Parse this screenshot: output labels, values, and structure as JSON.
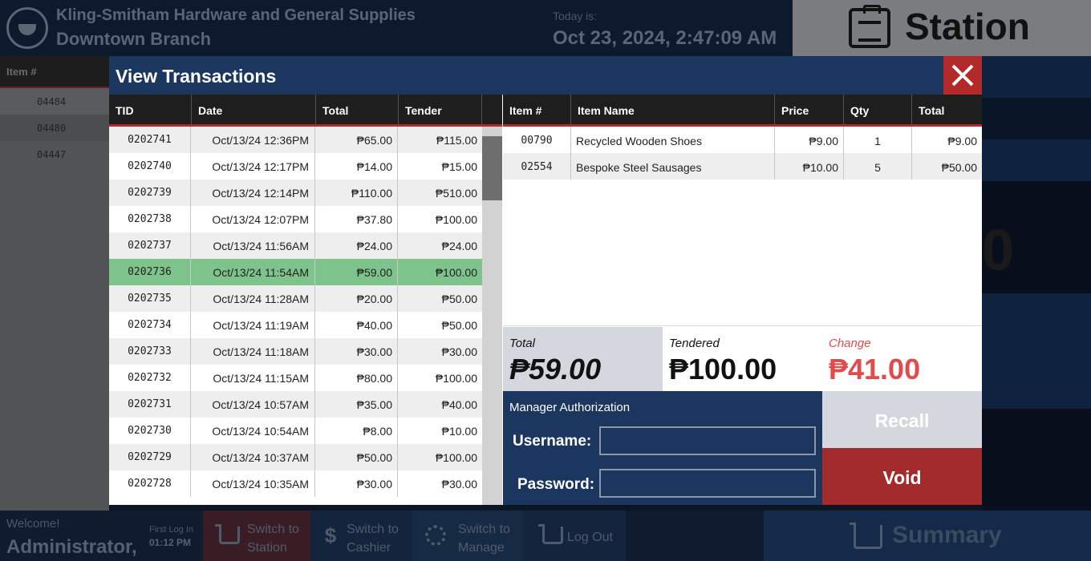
{
  "header": {
    "store_name": "Kling-Smitham Hardware and General Supplies",
    "branch": "Downtown Branch",
    "today_label": "Today is:",
    "today_value": "Oct 23, 2024, 2:47:09 AM",
    "station_label": "Station"
  },
  "background_list": {
    "header": "Item #",
    "rows": [
      "04484",
      "04480",
      "04447"
    ]
  },
  "bottombar": {
    "welcome": "Welcome!",
    "user": "Administrator,",
    "first_login_label": "First Log In",
    "first_login_time": "01:12 PM",
    "switch_station": [
      "Switch to",
      "Station"
    ],
    "switch_cashier": [
      "Switch to",
      "Cashier"
    ],
    "switch_manage": [
      "Switch to",
      "Manage"
    ],
    "logout": "Log Out",
    "summary": "Summary"
  },
  "modal": {
    "title": "View Transactions",
    "tx_columns": [
      "TID",
      "Date",
      "Total",
      "Tender"
    ],
    "transactions": [
      {
        "tid": "0202741",
        "date": "Oct/13/24 12:36PM",
        "total": "₱65.00",
        "tender": "₱115.00"
      },
      {
        "tid": "0202740",
        "date": "Oct/13/24 12:17PM",
        "total": "₱14.00",
        "tender": "₱15.00"
      },
      {
        "tid": "0202739",
        "date": "Oct/13/24 12:14PM",
        "total": "₱110.00",
        "tender": "₱510.00"
      },
      {
        "tid": "0202738",
        "date": "Oct/13/24 12:07PM",
        "total": "₱37.80",
        "tender": "₱100.00"
      },
      {
        "tid": "0202737",
        "date": "Oct/13/24 11:56AM",
        "total": "₱24.00",
        "tender": "₱24.00"
      },
      {
        "tid": "0202736",
        "date": "Oct/13/24 11:54AM",
        "total": "₱59.00",
        "tender": "₱100.00"
      },
      {
        "tid": "0202735",
        "date": "Oct/13/24 11:28AM",
        "total": "₱20.00",
        "tender": "₱50.00"
      },
      {
        "tid": "0202734",
        "date": "Oct/13/24 11:19AM",
        "total": "₱40.00",
        "tender": "₱50.00"
      },
      {
        "tid": "0202733",
        "date": "Oct/13/24 11:18AM",
        "total": "₱30.00",
        "tender": "₱30.00"
      },
      {
        "tid": "0202732",
        "date": "Oct/13/24 11:15AM",
        "total": "₱80.00",
        "tender": "₱100.00"
      },
      {
        "tid": "0202731",
        "date": "Oct/13/24 10:57AM",
        "total": "₱35.00",
        "tender": "₱40.00"
      },
      {
        "tid": "0202730",
        "date": "Oct/13/24 10:54AM",
        "total": "₱8.00",
        "tender": "₱10.00"
      },
      {
        "tid": "0202729",
        "date": "Oct/13/24 10:37AM",
        "total": "₱50.00",
        "tender": "₱100.00"
      },
      {
        "tid": "0202728",
        "date": "Oct/13/24 10:35AM",
        "total": "₱30.00",
        "tender": "₱30.00"
      }
    ],
    "selected_tid": "0202736",
    "item_columns": [
      "Item #",
      "Item Name",
      "Price",
      "Qty",
      "Total"
    ],
    "items": [
      {
        "num": "00790",
        "name": "Recycled Wooden Shoes",
        "price": "₱9.00",
        "qty": "1",
        "total": "₱9.00"
      },
      {
        "num": "02554",
        "name": "Bespoke Steel Sausages",
        "price": "₱10.00",
        "qty": "5",
        "total": "₱50.00"
      }
    ],
    "summary": {
      "total_label": "Total",
      "total_value": "₱59.00",
      "tendered_label": "Tendered",
      "tendered_value": "₱100.00",
      "change_label": "Change",
      "change_value": "₱41.00"
    },
    "auth": {
      "title": "Manager Authorization",
      "username_label": "Username:",
      "password_label": "Password:"
    },
    "recall_label": "Recall",
    "void_label": "Void"
  },
  "colors": {
    "header_blue": "#1b365f",
    "selected_row": "#7dc38b",
    "void_red": "#a32b2b",
    "change_red": "#e24b4b"
  }
}
